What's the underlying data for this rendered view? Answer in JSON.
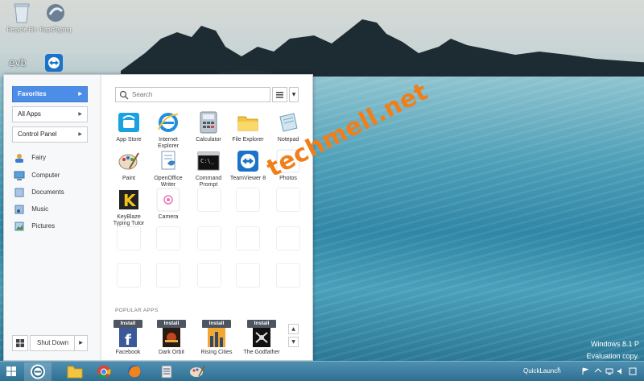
{
  "desktop": {
    "icons": [
      {
        "name": "recycle-bin",
        "label": "Recycle Bin"
      },
      {
        "name": "rapidtyping",
        "label": "RapidTyping"
      }
    ],
    "watermark": "techmell.net",
    "eval_line1": "Windows 8.1 P",
    "eval_line2": "Evaluation copy."
  },
  "menu": {
    "left": {
      "favorites": "Favorites",
      "all_apps": "All Apps",
      "control_panel": "Control Panel",
      "places": [
        "Fairy",
        "Computer",
        "Documents",
        "Music",
        "Pictures"
      ],
      "shutdown": "Shut Down"
    },
    "search": {
      "placeholder": "Search"
    },
    "apps": [
      "App Store",
      "Internet Explorer",
      "Calculator",
      "File Explorer",
      "Notepad",
      "Paint",
      "OpenOffice Writer",
      "Command Prompt",
      "TeamViewer 8",
      "Photos",
      "KeyBlaze Typing Tutor",
      "Camera"
    ],
    "popular": {
      "heading": "POPULAR APPS",
      "install_label": "Install",
      "items": [
        "Facebook",
        "Dark Orbit",
        "Rising Cities",
        "The Godfather"
      ]
    }
  },
  "taskbar": {
    "quicklaunch": "QuickLaunch",
    "chevron": "»"
  },
  "colors": {
    "accent": "#4c8de7",
    "watermark": "#f07f1a",
    "taskbar": "#2f6f92"
  }
}
